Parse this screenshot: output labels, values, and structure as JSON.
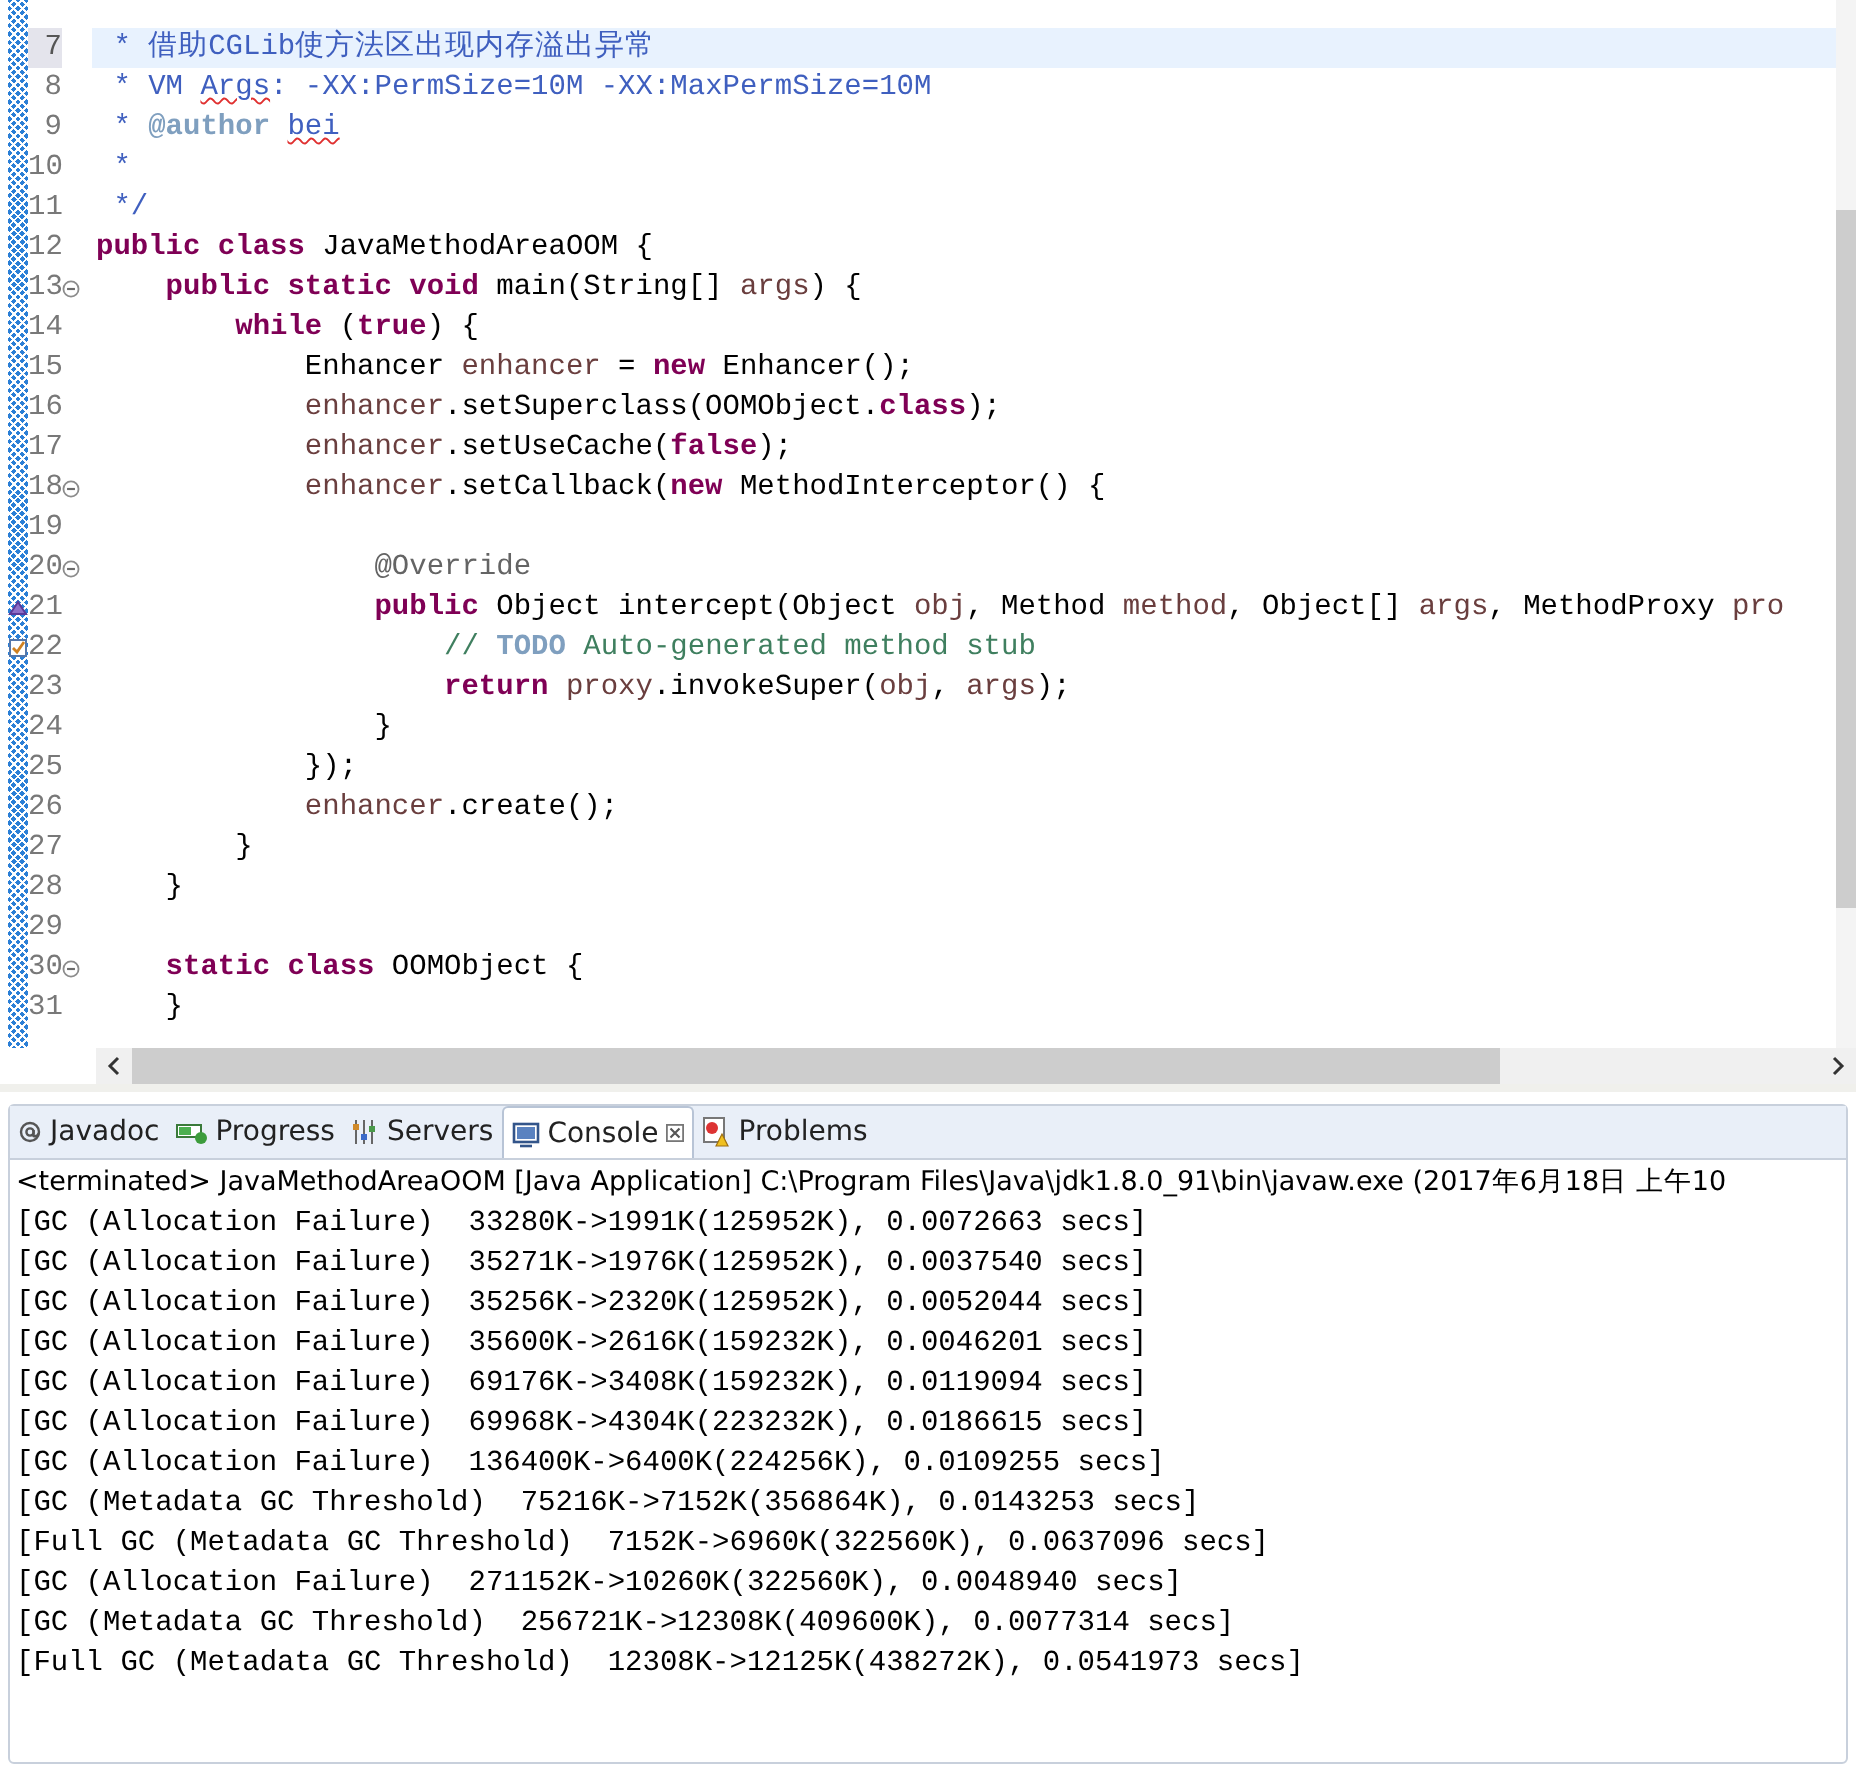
{
  "editor": {
    "lines": [
      {
        "number": "7",
        "kind": "code",
        "current": true,
        "tokens": [
          {
            "kind": "javadoc",
            "text": " * 借助CGLib使方法区出现内存溢出异常"
          }
        ]
      },
      {
        "number": "8",
        "kind": "code",
        "current": false,
        "tokens": [
          {
            "kind": "javadoc",
            "text": " * VM "
          },
          {
            "kind": "misspelled",
            "text": "Args"
          },
          {
            "kind": "javadoc",
            "text": ": -XX:PermSize=10M -XX:MaxPermSize=10M"
          }
        ]
      },
      {
        "number": "9",
        "kind": "code",
        "current": false,
        "tokens": [
          {
            "kind": "javadoc",
            "text": " * "
          },
          {
            "kind": "tag",
            "text": "@author "
          },
          {
            "kind": "misspelled",
            "text": "bei"
          }
        ]
      },
      {
        "number": "10",
        "kind": "code",
        "current": false,
        "tokens": [
          {
            "kind": "javadoc",
            "text": " *"
          }
        ]
      },
      {
        "number": "11",
        "kind": "code",
        "current": false,
        "tokens": [
          {
            "kind": "javadoc",
            "text": " */"
          }
        ]
      },
      {
        "number": "12",
        "kind": "code",
        "current": false,
        "tokens": [
          {
            "kind": "keyword",
            "text": "public class"
          },
          {
            "kind": "plain",
            "text": " JavaMethodAreaOOM {"
          }
        ]
      },
      {
        "number": "13",
        "kind": "code",
        "current": false,
        "fold": true,
        "tokens": [
          {
            "kind": "keyword",
            "text": "    public static void"
          },
          {
            "kind": "plain",
            "text": " main(String[] "
          },
          {
            "kind": "variable",
            "text": "args"
          },
          {
            "kind": "plain",
            "text": ") {"
          }
        ]
      },
      {
        "number": "14",
        "kind": "code",
        "current": false,
        "tokens": [
          {
            "kind": "keyword",
            "text": "        while"
          },
          {
            "kind": "plain",
            "text": " ("
          },
          {
            "kind": "keyword",
            "text": "true"
          },
          {
            "kind": "plain",
            "text": ") {"
          }
        ]
      },
      {
        "number": "15",
        "kind": "code",
        "current": false,
        "tokens": [
          {
            "kind": "plain",
            "text": "            Enhancer "
          },
          {
            "kind": "variable",
            "text": "enhancer"
          },
          {
            "kind": "plain",
            "text": " = "
          },
          {
            "kind": "keyword",
            "text": "new"
          },
          {
            "kind": "plain",
            "text": " Enhancer();"
          }
        ]
      },
      {
        "number": "16",
        "kind": "code",
        "current": false,
        "tokens": [
          {
            "kind": "variable",
            "text": "            enhancer"
          },
          {
            "kind": "plain",
            "text": ".setSuperclass(OOMObject."
          },
          {
            "kind": "keyword",
            "text": "class"
          },
          {
            "kind": "plain",
            "text": ");"
          }
        ]
      },
      {
        "number": "17",
        "kind": "code",
        "current": false,
        "tokens": [
          {
            "kind": "variable",
            "text": "            enhancer"
          },
          {
            "kind": "plain",
            "text": ".setUseCache("
          },
          {
            "kind": "keyword",
            "text": "false"
          },
          {
            "kind": "plain",
            "text": ");"
          }
        ]
      },
      {
        "number": "18",
        "kind": "code",
        "current": false,
        "fold": true,
        "tokens": [
          {
            "kind": "variable",
            "text": "            enhancer"
          },
          {
            "kind": "plain",
            "text": ".setCallback("
          },
          {
            "kind": "keyword",
            "text": "new"
          },
          {
            "kind": "plain",
            "text": " MethodInterceptor() {"
          }
        ]
      },
      {
        "number": "19",
        "kind": "code",
        "current": false
      },
      {
        "number": "20",
        "kind": "code",
        "current": false,
        "fold": true,
        "tokens": [
          {
            "kind": "annotation",
            "text": "                @Override"
          }
        ]
      },
      {
        "number": "21",
        "kind": "override",
        "current": false,
        "tokens": [
          {
            "kind": "keyword",
            "text": "                public"
          },
          {
            "kind": "plain",
            "text": " Object intercept(Object "
          },
          {
            "kind": "variable",
            "text": "obj"
          },
          {
            "kind": "plain",
            "text": ", Method "
          },
          {
            "kind": "variable",
            "text": "method"
          },
          {
            "kind": "plain",
            "text": ", Object[] "
          },
          {
            "kind": "variable",
            "text": "args"
          },
          {
            "kind": "plain",
            "text": ", MethodProxy "
          },
          {
            "kind": "variable",
            "text": "pro"
          }
        ]
      },
      {
        "number": "22",
        "kind": "task",
        "current": false,
        "tokens": [
          {
            "kind": "comment",
            "text": "                    // "
          },
          {
            "kind": "todo",
            "text": "TODO"
          },
          {
            "kind": "comment",
            "text": " Auto-generated method stub"
          }
        ]
      },
      {
        "number": "23",
        "kind": "code",
        "current": false,
        "tokens": [
          {
            "kind": "keyword",
            "text": "                    return"
          },
          {
            "kind": "variable",
            "text": " proxy"
          },
          {
            "kind": "plain",
            "text": ".invokeSuper("
          },
          {
            "kind": "variable",
            "text": "obj"
          },
          {
            "kind": "plain",
            "text": ", "
          },
          {
            "kind": "variable",
            "text": "args"
          },
          {
            "kind": "plain",
            "text": ");"
          }
        ]
      },
      {
        "number": "24",
        "kind": "code",
        "current": false,
        "tokens": [
          {
            "kind": "plain",
            "text": "                }"
          }
        ]
      },
      {
        "number": "25",
        "kind": "code",
        "current": false,
        "tokens": [
          {
            "kind": "plain",
            "text": "            });"
          }
        ]
      },
      {
        "number": "26",
        "kind": "code",
        "current": false,
        "tokens": [
          {
            "kind": "variable",
            "text": "            enhancer"
          },
          {
            "kind": "plain",
            "text": ".create();"
          }
        ]
      },
      {
        "number": "27",
        "kind": "code",
        "current": false,
        "tokens": [
          {
            "kind": "plain",
            "text": "        }"
          }
        ]
      },
      {
        "number": "28",
        "kind": "code",
        "current": false,
        "tokens": [
          {
            "kind": "plain",
            "text": "    }"
          }
        ]
      },
      {
        "number": "29",
        "kind": "code",
        "current": false
      },
      {
        "number": "30",
        "kind": "code",
        "current": false,
        "fold": true,
        "tokens": [
          {
            "kind": "keyword",
            "text": "    static class"
          },
          {
            "kind": "plain",
            "text": " OOMObject {"
          }
        ]
      },
      {
        "number": "31",
        "kind": "code",
        "current": false,
        "tokens": [
          {
            "kind": "plain",
            "text": "    }"
          }
        ]
      }
    ]
  },
  "console_panel": {
    "tabs": [
      {
        "label": "Javadoc",
        "selected": false
      },
      {
        "label": "Progress",
        "selected": false
      },
      {
        "label": "Servers",
        "selected": false
      },
      {
        "label": "Console",
        "selected": true
      },
      {
        "label": "Problems",
        "selected": false
      }
    ],
    "header": "<terminated> JavaMethodAreaOOM [Java Application] C:\\Program Files\\Java\\jdk1.8.0_91\\bin\\javaw.exe (2017年6月18日 上午10",
    "lines": [
      "[GC (Allocation Failure)  33280K->1991K(125952K), 0.0072663 secs]",
      "[GC (Allocation Failure)  35271K->1976K(125952K), 0.0037540 secs]",
      "[GC (Allocation Failure)  35256K->2320K(125952K), 0.0052044 secs]",
      "[GC (Allocation Failure)  35600K->2616K(159232K), 0.0046201 secs]",
      "[GC (Allocation Failure)  69176K->3408K(159232K), 0.0119094 secs]",
      "[GC (Allocation Failure)  69968K->4304K(223232K), 0.0186615 secs]",
      "[GC (Allocation Failure)  136400K->6400K(224256K), 0.0109255 secs]",
      "[GC (Metadata GC Threshold)  75216K->7152K(356864K), 0.0143253 secs]",
      "[Full GC (Metadata GC Threshold)  7152K->6960K(322560K), 0.0637096 secs]",
      "[GC (Allocation Failure)  271152K->10260K(322560K), 0.0048940 secs]",
      "[GC (Metadata GC Threshold)  256721K->12308K(409600K), 0.0077314 secs]",
      "[Full GC (Metadata GC Threshold)  12308K->12125K(438272K), 0.0541973 secs]"
    ]
  }
}
